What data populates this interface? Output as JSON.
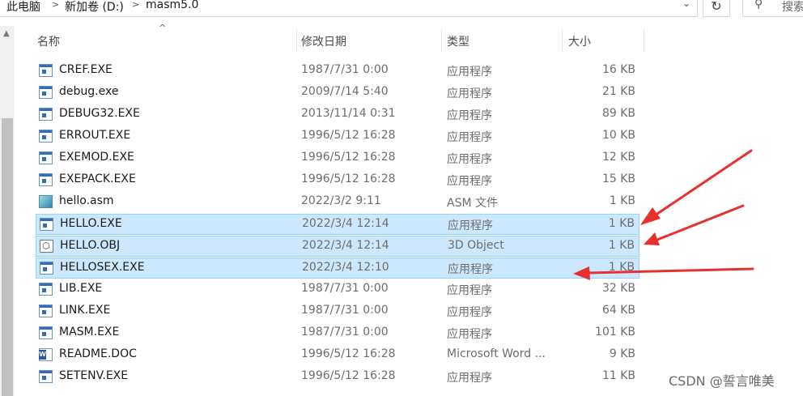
{
  "address": {
    "crumbs": [
      "此电脑",
      "新加卷 (D:)",
      "masm5.0"
    ],
    "separator": ">",
    "dropdown_icon": "chevron-down",
    "refresh_icon": "refresh",
    "search_placeholder": "搜索"
  },
  "columns": {
    "name": "名称",
    "date": "修改日期",
    "type": "类型",
    "size": "大小",
    "sort_indicator": "^"
  },
  "files": [
    {
      "name": "CREF.EXE",
      "date": "1987/7/31 0:00",
      "type": "应用程序",
      "size": "16 KB",
      "icon": "exe",
      "selected": false
    },
    {
      "name": "debug.exe",
      "date": "2009/7/14 5:40",
      "type": "应用程序",
      "size": "21 KB",
      "icon": "exe",
      "selected": false
    },
    {
      "name": "DEBUG32.EXE",
      "date": "2013/11/14 0:31",
      "type": "应用程序",
      "size": "89 KB",
      "icon": "exe",
      "selected": false
    },
    {
      "name": "ERROUT.EXE",
      "date": "1996/5/12 16:28",
      "type": "应用程序",
      "size": "10 KB",
      "icon": "exe",
      "selected": false
    },
    {
      "name": "EXEMOD.EXE",
      "date": "1996/5/12 16:28",
      "type": "应用程序",
      "size": "12 KB",
      "icon": "exe",
      "selected": false
    },
    {
      "name": "EXEPACK.EXE",
      "date": "1996/5/12 16:28",
      "type": "应用程序",
      "size": "15 KB",
      "icon": "exe",
      "selected": false
    },
    {
      "name": "hello.asm",
      "date": "2022/3/2 9:11",
      "type": "ASM 文件",
      "size": "1 KB",
      "icon": "asm",
      "selected": false
    },
    {
      "name": "HELLO.EXE",
      "date": "2022/3/4 12:14",
      "type": "应用程序",
      "size": "1 KB",
      "icon": "exe",
      "selected": true
    },
    {
      "name": "HELLO.OBJ",
      "date": "2022/3/4 12:14",
      "type": "3D Object",
      "size": "1 KB",
      "icon": "obj",
      "selected": true
    },
    {
      "name": "HELLOSEX.EXE",
      "date": "2022/3/4 12:10",
      "type": "应用程序",
      "size": "1 KB",
      "icon": "exe",
      "selected": true
    },
    {
      "name": "LIB.EXE",
      "date": "1987/7/31 0:00",
      "type": "应用程序",
      "size": "32 KB",
      "icon": "exe",
      "selected": false
    },
    {
      "name": "LINK.EXE",
      "date": "1987/7/31 0:00",
      "type": "应用程序",
      "size": "64 KB",
      "icon": "exe",
      "selected": false
    },
    {
      "name": "MASM.EXE",
      "date": "1987/7/31 0:00",
      "type": "应用程序",
      "size": "101 KB",
      "icon": "exe",
      "selected": false
    },
    {
      "name": "README.DOC",
      "date": "1996/5/12 16:28",
      "type": "Microsoft Word ...",
      "size": "9 KB",
      "icon": "doc",
      "selected": false
    },
    {
      "name": "SETENV.EXE",
      "date": "1996/5/12 16:28",
      "type": "应用程序",
      "size": "11 KB",
      "icon": "exe",
      "selected": false
    }
  ],
  "annotation_arrow_color": "#e8312f",
  "selection_color": "#cce8ff",
  "watermark": "CSDN @誓言唯美"
}
